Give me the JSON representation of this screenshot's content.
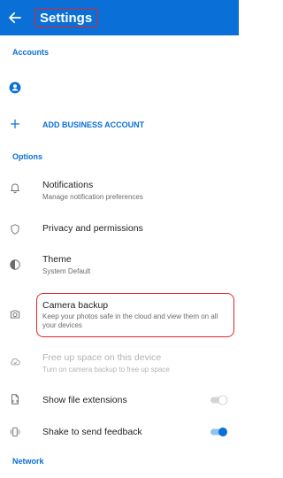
{
  "header": {
    "title": "Settings"
  },
  "sections": {
    "accounts": "Accounts",
    "options": "Options",
    "network": "Network"
  },
  "accounts": {
    "add_business": "ADD BUSINESS ACCOUNT"
  },
  "options": {
    "notifications": {
      "title": "Notifications",
      "subtitle": "Manage notification preferences"
    },
    "privacy": {
      "title": "Privacy and permissions"
    },
    "theme": {
      "title": "Theme",
      "subtitle": "System Default"
    },
    "camera_backup": {
      "title": "Camera backup",
      "subtitle": "Keep your photos safe in the cloud and view them on all your devices"
    },
    "free_up_space": {
      "title": "Free up space on this device",
      "subtitle": "Turn on camera backup to free up space"
    },
    "show_file_extensions": {
      "title": "Show file extensions",
      "enabled": false
    },
    "shake_to_send_feedback": {
      "title": "Shake to send feedback",
      "enabled": true
    }
  },
  "colors": {
    "accent": "#0a6fd6",
    "highlight": "#e0242b"
  },
  "icons": {
    "back": "arrow-left-icon",
    "account": "account-avatar-icon",
    "add": "plus-icon",
    "notifications": "bell-icon",
    "privacy": "shield-icon",
    "theme": "half-circle-icon",
    "camera": "camera-icon",
    "free_up_space": "cloud-check-icon",
    "file_extensions": "file-icon",
    "shake": "phone-vibrate-icon"
  }
}
